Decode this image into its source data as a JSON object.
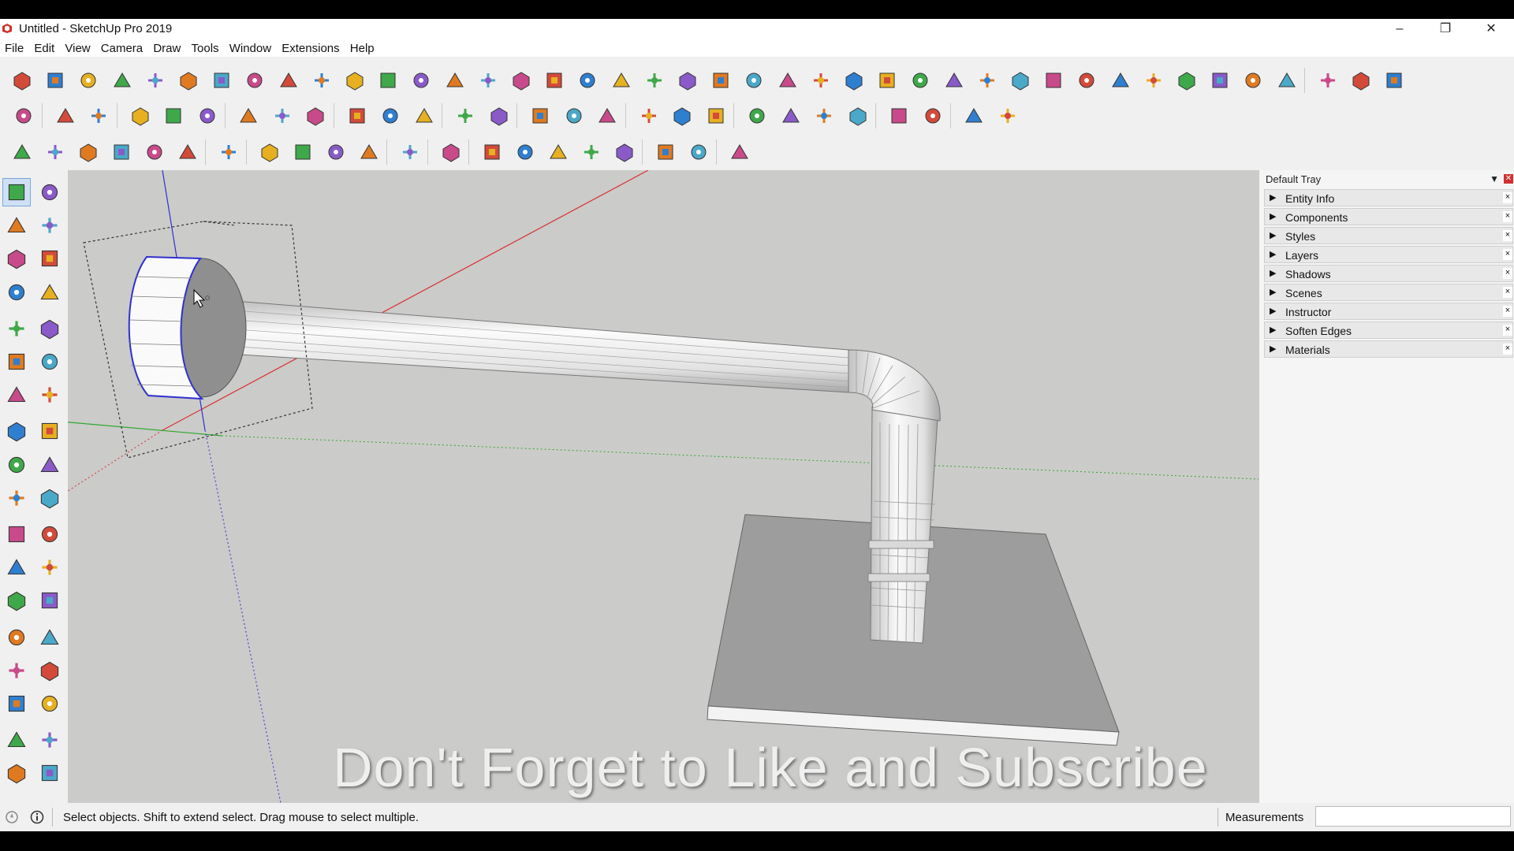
{
  "window": {
    "title": "Untitled - SketchUp Pro 2019",
    "controls": [
      "minimize-icon",
      "restore-icon",
      "close-icon"
    ]
  },
  "menu": [
    "File",
    "Edit",
    "View",
    "Camera",
    "Draw",
    "Tools",
    "Window",
    "Extensions",
    "Help"
  ],
  "tray": {
    "title": "Default Tray",
    "panels": [
      "Entity Info",
      "Components",
      "Styles",
      "Layers",
      "Shadows",
      "Scenes",
      "Instructor",
      "Soften Edges",
      "Materials"
    ]
  },
  "viewport": {
    "overlay_text": "Don't Forget to Like and Subscribe",
    "background_color": "#cbcbc9",
    "axis_colors": {
      "red": "#d83030",
      "green": "#2fa82f",
      "blue": "#3030d0"
    }
  },
  "status": {
    "text": "Select objects. Shift to extend select. Drag mouse to select multiple.",
    "measurements_label": "Measurements",
    "measurements_value": ""
  },
  "left_tools": [
    "select-tool-icon",
    "component-tool-icon",
    "paint-bucket-icon",
    "eraser-icon",
    "line-tool-icon",
    "freehand-tool-icon",
    "rectangle-tool-icon",
    "rotated-rectangle-icon",
    "circle-tool-icon",
    "polygon-tool-icon",
    "arc-tool-icon",
    "two-point-arc-icon",
    "three-point-arc-icon",
    "pie-tool-icon",
    "move-tool-icon",
    "push-pull-icon",
    "rotate-tool-icon",
    "follow-me-icon",
    "scale-tool-icon",
    "offset-tool-icon",
    "tape-measure-icon",
    "dimension-tool-icon",
    "protractor-icon",
    "text-tool-icon",
    "axes-tool-icon",
    "3d-text-icon",
    "orbit-tool-icon",
    "pan-tool-icon",
    "zoom-tool-icon",
    "zoom-window-icon",
    "zoom-extents-icon",
    "previous-view-icon",
    "position-camera-icon",
    "look-around-icon",
    "walk-tool-icon",
    "section-plane-icon"
  ]
}
